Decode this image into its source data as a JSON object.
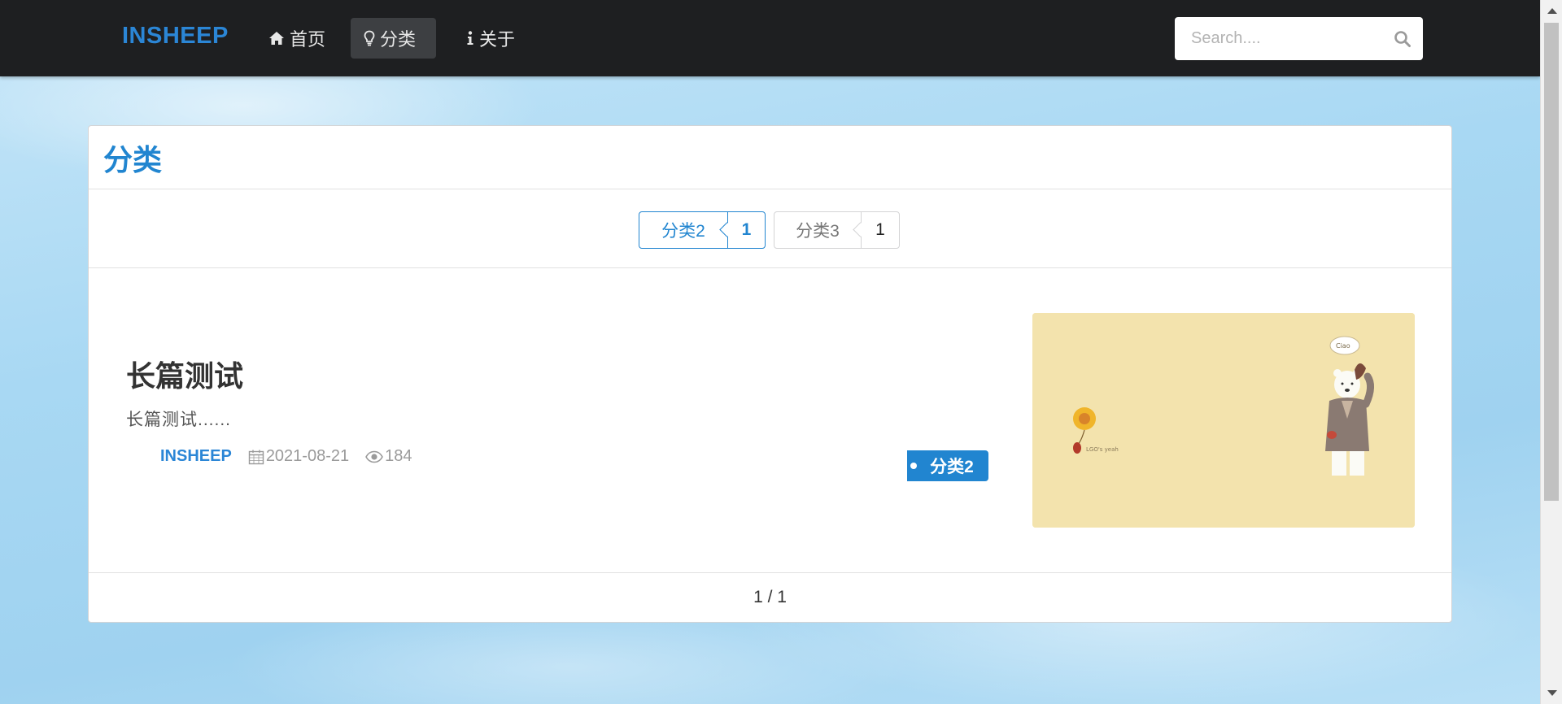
{
  "navbar": {
    "brand": "INSHEEP",
    "items": [
      {
        "label": "首页",
        "icon": "home-icon",
        "active": false
      },
      {
        "label": "分类",
        "icon": "lightbulb-icon",
        "active": true
      },
      {
        "label": "关于",
        "icon": "info-icon",
        "active": false
      }
    ],
    "search": {
      "placeholder": "Search....",
      "value": ""
    }
  },
  "page": {
    "title": "分类",
    "categories": [
      {
        "name": "分类2",
        "count": "1",
        "selected": true
      },
      {
        "name": "分类3",
        "count": "1",
        "selected": false
      }
    ],
    "posts": [
      {
        "title": "长篇测试",
        "excerpt": "长篇测试......",
        "author": "INSHEEP",
        "date": "2021-08-21",
        "views": "184",
        "tag": "分类2",
        "thumbnail": "yellow illustration with polar bear in suit"
      }
    ],
    "pagination": "1 / 1"
  },
  "colors": {
    "accent": "#2185d0",
    "navbar_bg": "#1e1f21",
    "thumbnail_bg": "#f3e3ad"
  }
}
